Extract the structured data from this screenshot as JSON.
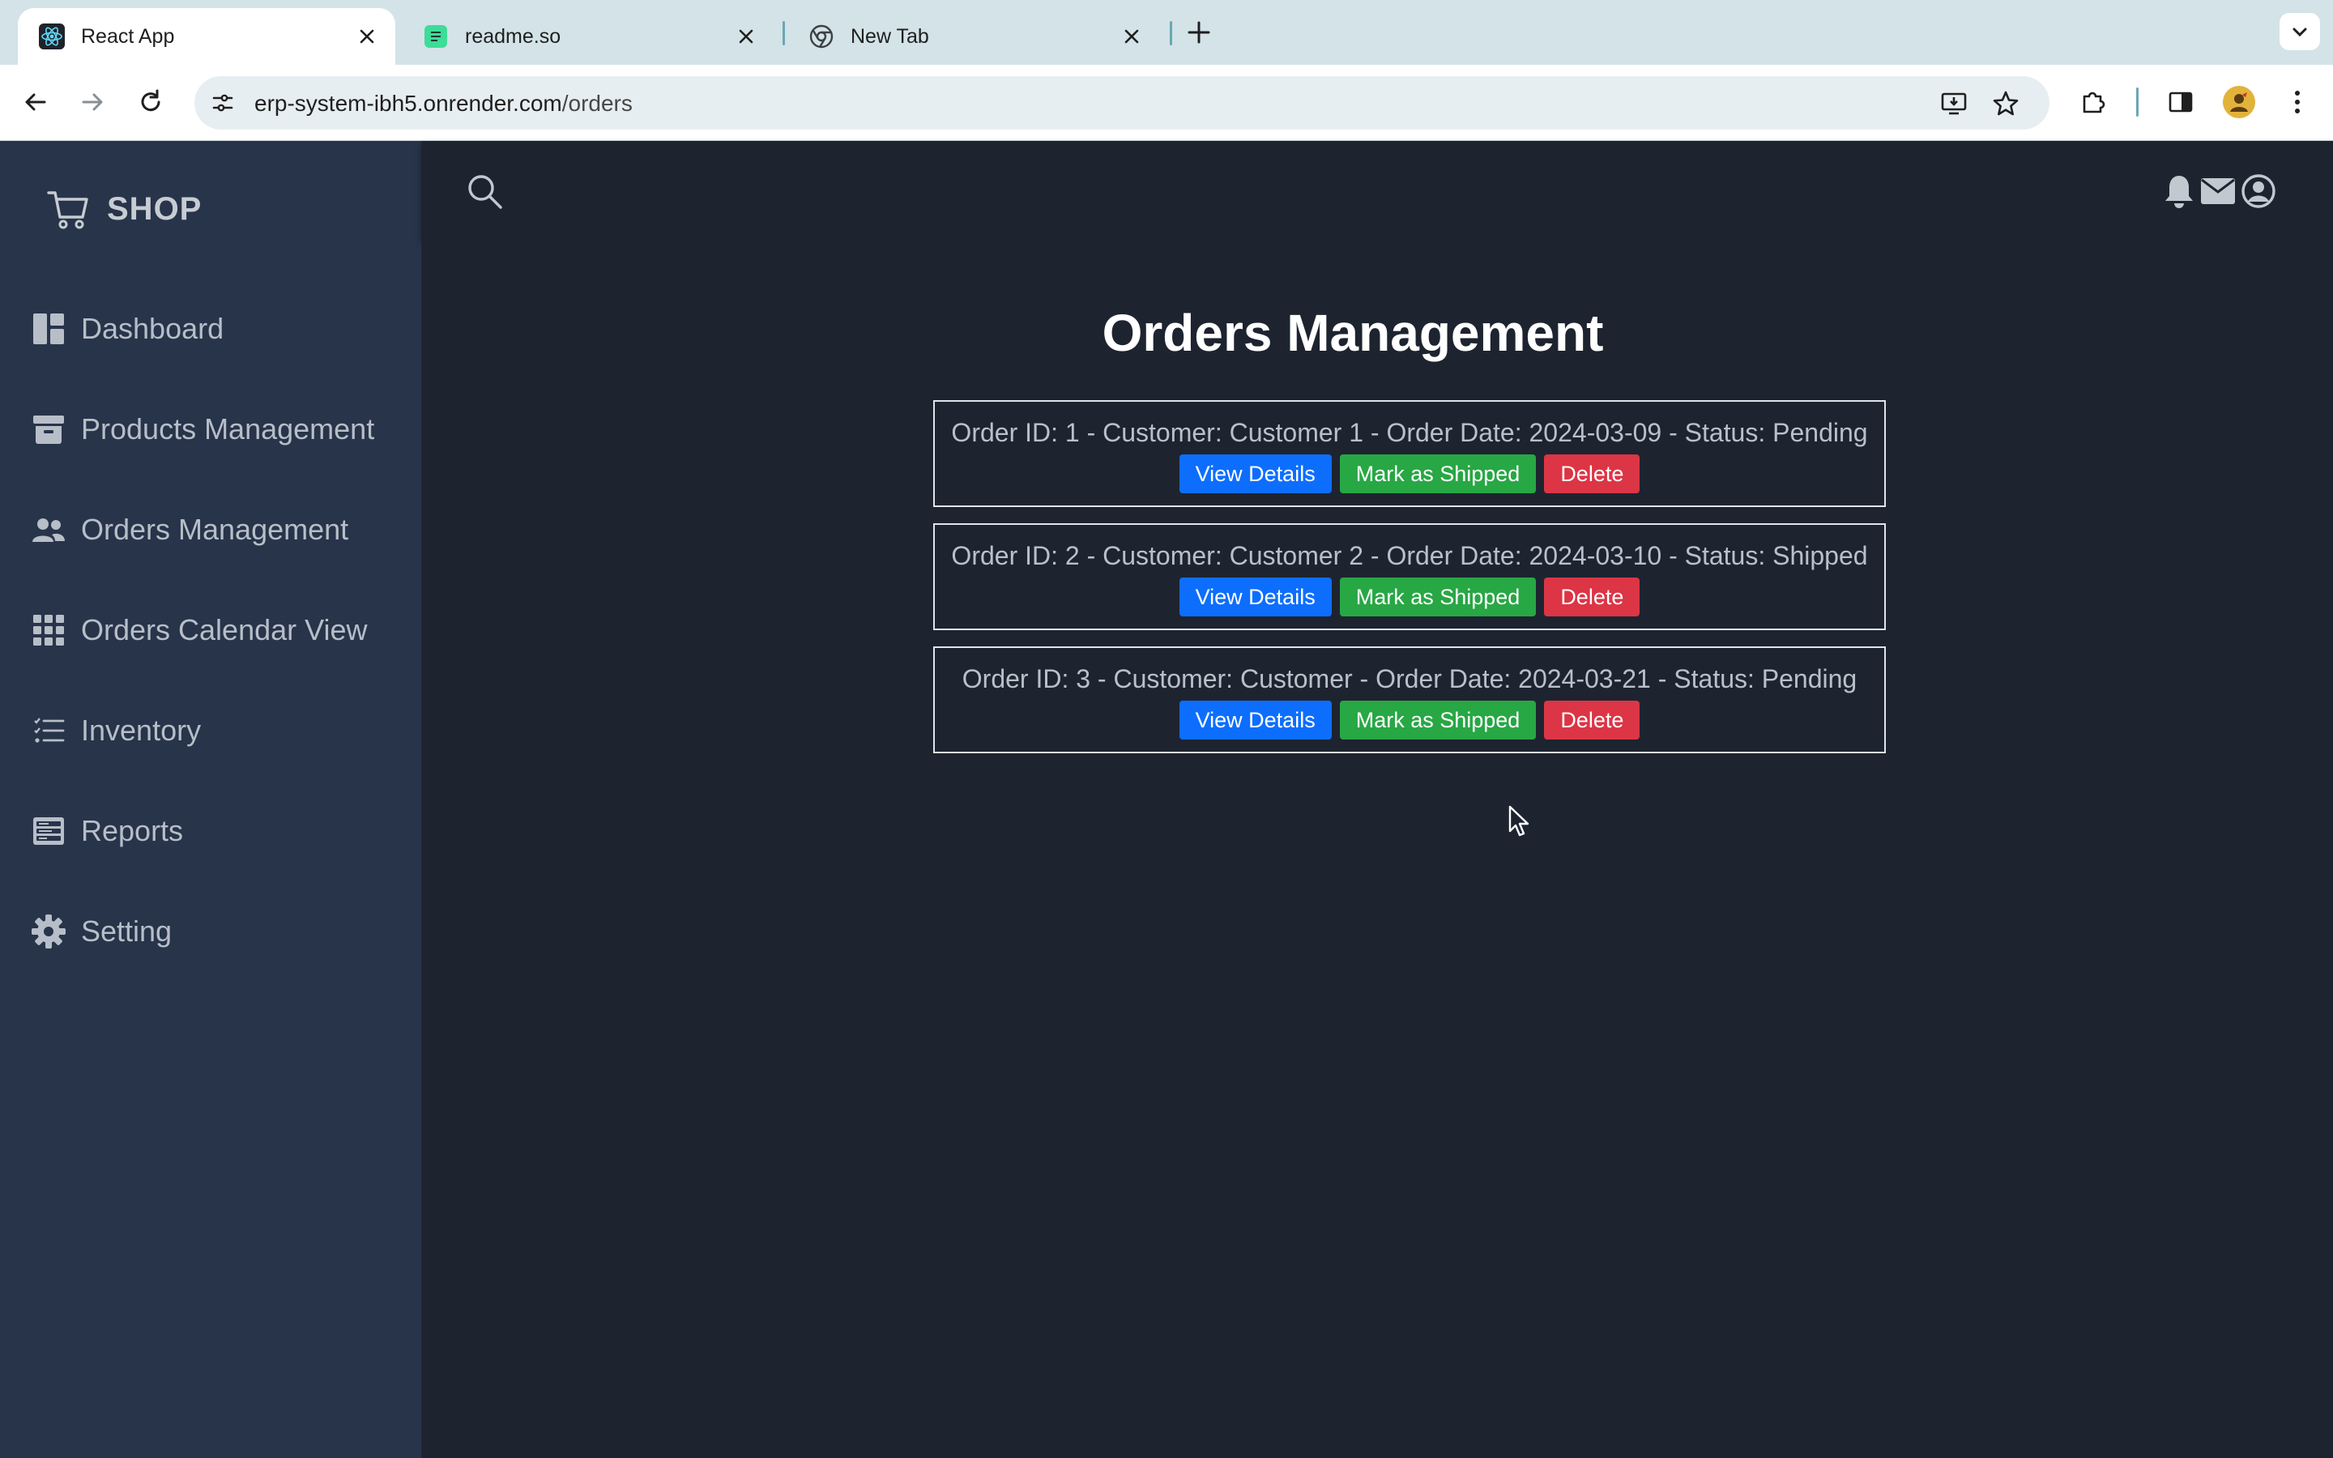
{
  "browser": {
    "tabs": [
      {
        "title": "React App",
        "icon": "react-icon",
        "active": true
      },
      {
        "title": "readme.so",
        "icon": "readme-icon",
        "active": false
      },
      {
        "title": "New Tab",
        "icon": "chrome-icon",
        "active": false
      }
    ],
    "url_host": "erp-system-ibh5.onrender.com",
    "url_path": "/orders"
  },
  "sidebar": {
    "brand": "SHOP",
    "items": [
      {
        "label": "Dashboard",
        "icon": "dashboard-icon"
      },
      {
        "label": "Products Management",
        "icon": "archive-icon"
      },
      {
        "label": "Orders Management",
        "icon": "users-icon"
      },
      {
        "label": "Orders Calendar View",
        "icon": "grid-icon"
      },
      {
        "label": "Inventory",
        "icon": "list-icon"
      },
      {
        "label": "Reports",
        "icon": "reports-icon"
      },
      {
        "label": "Setting",
        "icon": "gear-icon"
      }
    ]
  },
  "main": {
    "title": "Orders Management",
    "orders": [
      {
        "info": "Order ID: 1 - Customer: Customer 1 - Order Date: 2024-03-09 - Status: Pending"
      },
      {
        "info": "Order ID: 2 - Customer: Customer 2 - Order Date: 2024-03-10 - Status: Shipped"
      },
      {
        "info": "Order ID: 3 - Customer: Customer - Order Date: 2024-03-21 - Status: Pending"
      }
    ],
    "buttons": {
      "view": "View Details",
      "ship": "Mark as Shipped",
      "delete": "Delete"
    }
  },
  "colors": {
    "sidebar_bg": "#27344a",
    "main_bg": "#1d2430",
    "view_btn": "#0d6efd",
    "ship_btn": "#28a745",
    "delete_btn": "#dc3545"
  }
}
